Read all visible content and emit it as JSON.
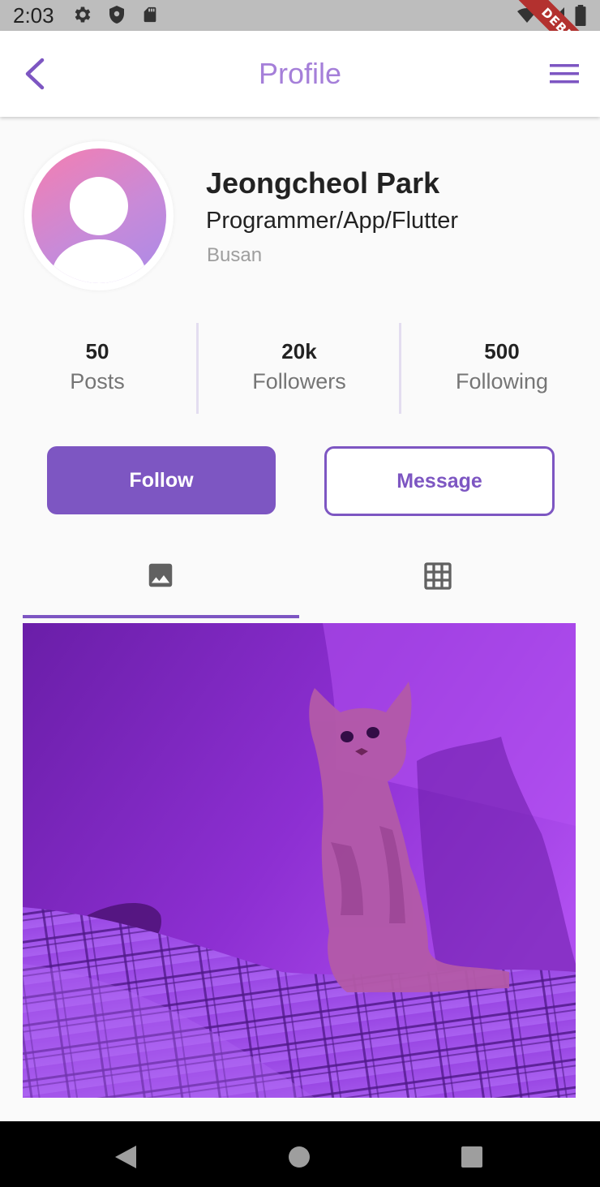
{
  "status_bar": {
    "time": "2:03",
    "debug_label": "DEBUG"
  },
  "app_bar": {
    "title": "Profile"
  },
  "profile": {
    "name": "Jeongcheol Park",
    "role": "Programmer/App/Flutter",
    "location": "Busan"
  },
  "stats": [
    {
      "value": "50",
      "label": "Posts"
    },
    {
      "value": "20k",
      "label": "Followers"
    },
    {
      "value": "500",
      "label": "Following"
    }
  ],
  "actions": {
    "follow_label": "Follow",
    "message_label": "Message"
  },
  "tabs": [
    {
      "icon": "image-icon",
      "selected": true
    },
    {
      "icon": "grid-icon",
      "selected": false
    }
  ],
  "colors": {
    "accent": "#7d56c2",
    "title": "#a57fd9",
    "photo_tint": "#8b2fd6"
  }
}
